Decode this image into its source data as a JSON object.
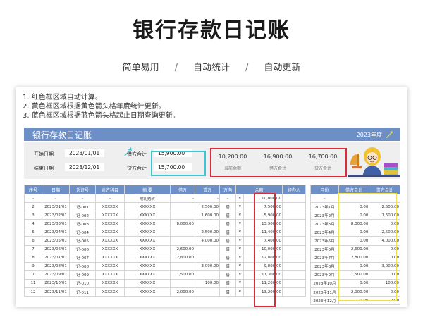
{
  "header": {
    "title": "银行存款日记账",
    "features": [
      "简单易用",
      "自动统计",
      "自动更新"
    ],
    "separator": "/"
  },
  "notes": [
    "1. 红色框区域自动计算。",
    "2. 黄色框区域根据黄色箭头格年度统计更新。",
    "3. 蓝色框区域根据蓝色箭头格起止日期查询更新。"
  ],
  "sheet": {
    "title": "银行存款日记账",
    "year": "2023年度",
    "start_label": "开始日期",
    "start_date": "2023/01/01",
    "end_label": "结束日期",
    "end_date": "2023/12/01",
    "debit_label": "借方合计",
    "debit_total": "15,900.00",
    "credit_label": "贷方合计",
    "credit_total": "15,700.00",
    "summary": [
      {
        "value": "10,200.00",
        "label": "当前余额"
      },
      {
        "value": "16,900.00",
        "label": "借方合计"
      },
      {
        "value": "16,700.00",
        "label": "贷方合计"
      }
    ],
    "colors": {
      "header_blue": "#6d8fc7",
      "red_box": "#d92b3a",
      "yellow_box": "#f0e04a",
      "cyan_box": "#3fc5d4"
    }
  },
  "ledger": {
    "columns": [
      "序号",
      "日期",
      "凭证号",
      "对方科目",
      "摘 要",
      "借方",
      "贷方",
      "方向",
      "余额",
      "经办人"
    ],
    "opening_row": [
      "-",
      "-",
      "-",
      "-",
      "期初结转",
      "-",
      "-",
      "-",
      "¥",
      "10,000.00",
      ""
    ],
    "rows": [
      [
        "2",
        "2023/01/01",
        "记-001",
        "XXXXXX",
        "XXXXXX",
        "",
        "2,500.00",
        "借",
        "¥",
        "7,500.00",
        ""
      ],
      [
        "3",
        "2023/02/01",
        "记-002",
        "XXXXXX",
        "XXXXXX",
        "",
        "1,600.00",
        "借",
        "¥",
        "5,900.00",
        ""
      ],
      [
        "4",
        "2023/03/01",
        "记-003",
        "XXXXXX",
        "XXXXXX",
        "8,000.00",
        "",
        "借",
        "¥",
        "13,900.00",
        ""
      ],
      [
        "5",
        "2023/04/01",
        "记-004",
        "XXXXXX",
        "XXXXXX",
        "",
        "2,500.00",
        "借",
        "¥",
        "11,400.00",
        ""
      ],
      [
        "6",
        "2023/05/01",
        "记-005",
        "XXXXXX",
        "XXXXXX",
        "",
        "4,000.00",
        "借",
        "¥",
        "7,400.00",
        ""
      ],
      [
        "7",
        "2023/06/01",
        "记-006",
        "XXXXXX",
        "XXXXXX",
        "2,600.00",
        "",
        "借",
        "¥",
        "10,000.00",
        ""
      ],
      [
        "8",
        "2023/07/01",
        "记-007",
        "XXXXXX",
        "XXXXXX",
        "2,800.00",
        "",
        "借",
        "¥",
        "12,800.00",
        ""
      ],
      [
        "9",
        "2023/08/01",
        "记-008",
        "XXXXXX",
        "XXXXXX",
        "",
        "3,000.00",
        "借",
        "¥",
        "9,800.00",
        ""
      ],
      [
        "10",
        "2023/09/01",
        "记-009",
        "XXXXXX",
        "XXXXXX",
        "1,500.00",
        "",
        "借",
        "¥",
        "11,300.00",
        ""
      ],
      [
        "11",
        "2023/10/01",
        "记-010",
        "XXXXXX",
        "XXXXXX",
        "",
        "100.00",
        "借",
        "¥",
        "11,200.00",
        ""
      ],
      [
        "12",
        "2023/11/01",
        "记-011",
        "XXXXXX",
        "XXXXXX",
        "2,000.00",
        "",
        "借",
        "¥",
        "13,200.00",
        ""
      ]
    ]
  },
  "monthly": {
    "columns": [
      "月份",
      "借方合计",
      "贷方合计"
    ],
    "rows": [
      [
        "-",
        "",
        ""
      ],
      [
        "2023年1月",
        "0.00",
        "2,500.00"
      ],
      [
        "2023年2月",
        "0.00",
        "1,600.00"
      ],
      [
        "2023年3月",
        "8,000.00",
        "0.00"
      ],
      [
        "2023年4月",
        "0.00",
        "2,500.00"
      ],
      [
        "2023年5月",
        "0.00",
        "4,000.00"
      ],
      [
        "2023年6月",
        "2,600.00",
        "0.00"
      ],
      [
        "2023年7月",
        "2,800.00",
        "0.00"
      ],
      [
        "2023年8月",
        "0.00",
        "3,000.00"
      ],
      [
        "2023年9月",
        "1,500.00",
        "0.00"
      ],
      [
        "2023年10月",
        "0.00",
        "100.00"
      ],
      [
        "2023年11月",
        "2,000.00",
        "0.00"
      ],
      [
        "2023年12月",
        "0.00",
        "0.00"
      ]
    ]
  }
}
